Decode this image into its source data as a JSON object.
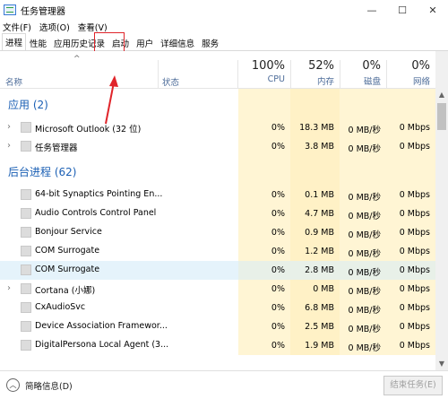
{
  "window": {
    "title": "任务管理器",
    "controls": [
      "—",
      "☐",
      "✕"
    ]
  },
  "menu": [
    "文件(F)",
    "选项(O)",
    "查看(V)"
  ],
  "tabs": [
    {
      "label": "进程",
      "active": true
    },
    {
      "label": "性能",
      "active": false
    },
    {
      "label": "应用历史记录",
      "active": false
    },
    {
      "label": "启动",
      "active": false
    },
    {
      "label": "用户",
      "active": false
    },
    {
      "label": "详细信息",
      "active": false
    },
    {
      "label": "服务",
      "active": false
    }
  ],
  "header": {
    "name": "名称",
    "status": "状态",
    "cpu_pct": "100%",
    "cpu_label": "CPU",
    "mem_pct": "52%",
    "mem_label": "内存",
    "disk_pct": "0%",
    "disk_label": "磁盘",
    "net_pct": "0%",
    "net_label": "网络"
  },
  "groups": {
    "apps": "应用 (2)",
    "background": "后台进程 (62)"
  },
  "apps": [
    {
      "name": "Microsoft Outlook (32 位)",
      "cpu": "0%",
      "mem": "18.3 MB",
      "disk": "0 MB/秒",
      "net": "0 Mbps",
      "expandable": true
    },
    {
      "name": "任务管理器",
      "cpu": "0%",
      "mem": "3.8 MB",
      "disk": "0 MB/秒",
      "net": "0 Mbps",
      "expandable": true
    }
  ],
  "background": [
    {
      "name": "64-bit Synaptics Pointing En...",
      "cpu": "0%",
      "mem": "0.1 MB",
      "disk": "0 MB/秒",
      "net": "0 Mbps",
      "expandable": false
    },
    {
      "name": "Audio Controls Control Panel",
      "cpu": "0%",
      "mem": "4.7 MB",
      "disk": "0 MB/秒",
      "net": "0 Mbps",
      "expandable": false
    },
    {
      "name": "Bonjour Service",
      "cpu": "0%",
      "mem": "0.9 MB",
      "disk": "0 MB/秒",
      "net": "0 Mbps",
      "expandable": false
    },
    {
      "name": "COM Surrogate",
      "cpu": "0%",
      "mem": "1.2 MB",
      "disk": "0 MB/秒",
      "net": "0 Mbps",
      "expandable": false
    },
    {
      "name": "COM Surrogate",
      "cpu": "0%",
      "mem": "2.8 MB",
      "disk": "0 MB/秒",
      "net": "0 Mbps",
      "expandable": false,
      "selected": true
    },
    {
      "name": "Cortana (小娜)",
      "cpu": "0%",
      "mem": "0 MB",
      "disk": "0 MB/秒",
      "net": "0 Mbps",
      "expandable": true
    },
    {
      "name": "CxAudioSvc",
      "cpu": "0%",
      "mem": "6.8 MB",
      "disk": "0 MB/秒",
      "net": "0 Mbps",
      "expandable": false
    },
    {
      "name": "Device Association Framewor...",
      "cpu": "0%",
      "mem": "2.5 MB",
      "disk": "0 MB/秒",
      "net": "0 Mbps",
      "expandable": false
    },
    {
      "name": "DigitalPersona Local Agent (3...",
      "cpu": "0%",
      "mem": "1.9 MB",
      "disk": "0 MB/秒",
      "net": "0 Mbps",
      "expandable": false
    }
  ],
  "footer": {
    "collapse_label": "简略信息(D)",
    "end_task": "结束任务(E)"
  },
  "colors": {
    "group_text": "#1a5fb4",
    "header_label": "#4d6c99",
    "highlight": "#e0242a",
    "cell_shade": "#fff5d4",
    "selected_row": "#e5f3fb"
  }
}
